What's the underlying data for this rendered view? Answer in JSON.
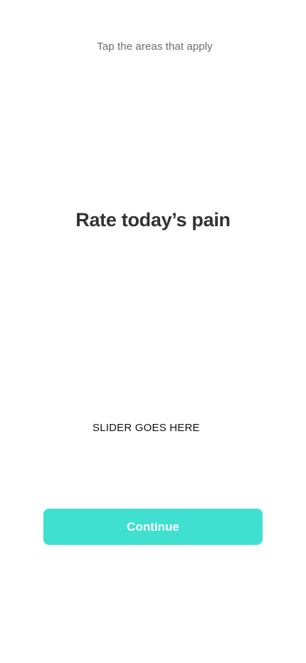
{
  "header": {
    "subtitle": "Tap the areas that apply"
  },
  "main": {
    "title": "Rate today’s pain",
    "slider_placeholder": "SLIDER GOES HERE"
  },
  "footer": {
    "continue_label": "Continue"
  },
  "colors": {
    "accent": "#40e0d0",
    "title_text": "#333333",
    "subtitle_text": "#6b6b6b",
    "background": "#ffffff"
  }
}
